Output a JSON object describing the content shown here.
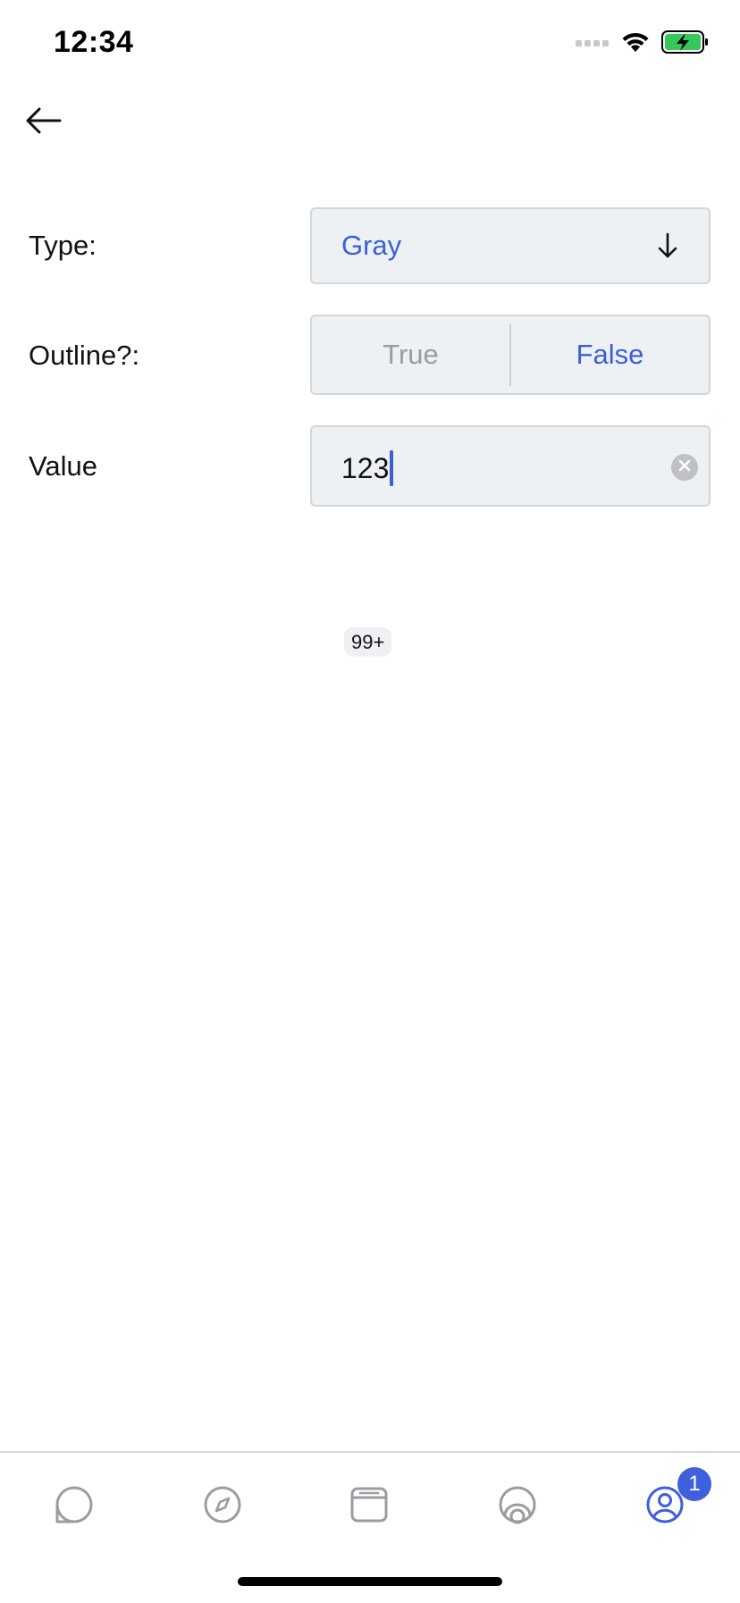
{
  "status_bar": {
    "time": "12:34",
    "icons": [
      "cellular-signal-icon",
      "wifi-icon",
      "battery-charging-icon"
    ],
    "battery_color": "#34c759"
  },
  "header": {
    "back_icon": "arrow-left-icon"
  },
  "form": {
    "type": {
      "label": "Type:",
      "selected": "Gray",
      "icon": "arrow-down-icon"
    },
    "outline": {
      "label": "Outline?:",
      "options": [
        "True",
        "False"
      ],
      "selected": "False"
    },
    "value": {
      "label": "Value",
      "input_value": "123",
      "clear_icon": "clear-icon"
    }
  },
  "preview": {
    "badge_text": "99+"
  },
  "tab_bar": {
    "tabs": [
      {
        "icon": "chat-bubble-icon"
      },
      {
        "icon": "compass-icon"
      },
      {
        "icon": "window-icon"
      },
      {
        "icon": "target-icon"
      },
      {
        "icon": "profile-icon",
        "active": true
      }
    ],
    "profile_badge": "1",
    "accent_color": "#3f5fdc",
    "inactive_color": "#9a9ca0"
  }
}
